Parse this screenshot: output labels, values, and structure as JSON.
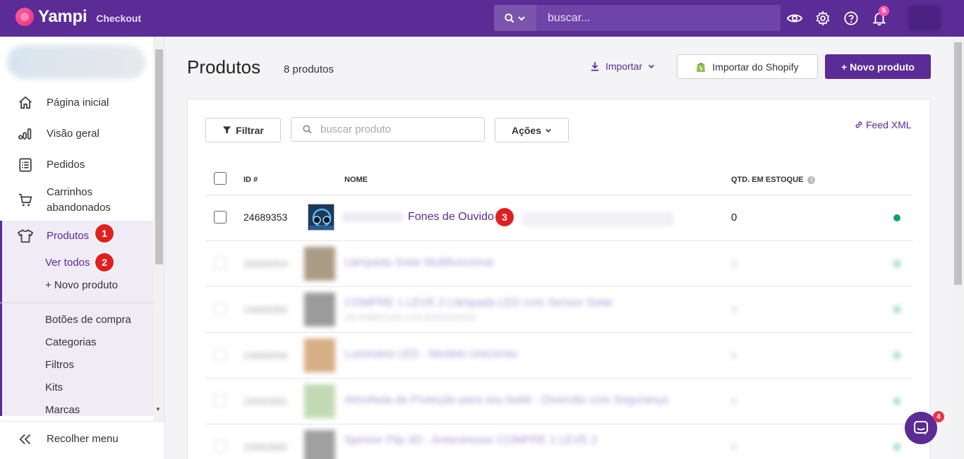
{
  "topbar": {
    "brand": "Yampi",
    "product": "Checkout",
    "search_placeholder": "buscar...",
    "notifications_count": "5"
  },
  "sidebar": {
    "items": [
      {
        "label": "Página inicial",
        "icon": "home-icon"
      },
      {
        "label": "Visão geral",
        "icon": "chart-icon"
      },
      {
        "label": "Pedidos",
        "icon": "list-icon"
      },
      {
        "label": "Carrinhos abandonados",
        "icon": "cart-icon"
      },
      {
        "label": "Produtos",
        "icon": "shirt-icon"
      }
    ],
    "products_sub": [
      "Ver todos",
      "+ Novo produto"
    ],
    "more": [
      "Botões de compra",
      "Categorias",
      "Filtros",
      "Kits",
      "Marcas"
    ],
    "collapse_label": "Recolher menu"
  },
  "page": {
    "title": "Produtos",
    "count": "8 produtos",
    "import_label": "Importar",
    "shopify_label": "Importar do Shopify",
    "new_product_label": "+ Novo produto"
  },
  "toolbar": {
    "filter_label": "Filtrar",
    "search_placeholder": "buscar produto",
    "actions_label": "Ações",
    "feed_label": "Feed XML"
  },
  "table": {
    "columns": [
      "ID #",
      "NOME",
      "QTD. EM ESTOQUE"
    ],
    "rows": [
      {
        "id": "24689353",
        "name": "Fones de Ouvido",
        "qty": "0"
      }
    ],
    "blurred_rows": [
      {
        "id": "24689354",
        "name": "Lâmpada Solar Multifuncional",
        "sub": "",
        "qty": "0"
      },
      {
        "id": "24689355",
        "name": "COMPRE 1 LEVE 2 Lâmpada LED com Sensor Solar",
        "sub": "UM FABRICADO LIVE BIODEGRADE",
        "qty": "0"
      },
      {
        "id": "24689356",
        "name": "Luminária LED - Modelo Unicórnio",
        "sub": "",
        "qty": "0"
      },
      {
        "id": "23592881",
        "name": "Almofada de Proteção para seu bebê - Diversão com Segurança",
        "sub": "",
        "qty": "0"
      },
      {
        "id": "23592882",
        "name": "Spinner Flip 3D - Antiestresse COMPRE 1 LEVE 2",
        "sub": "",
        "qty": "0"
      }
    ]
  },
  "annotations": [
    "1",
    "2",
    "3"
  ],
  "chat": {
    "badge": "4"
  },
  "colors": {
    "brand": "#5b2b96",
    "active_status": "#12a06a",
    "badge": "#e02020"
  }
}
